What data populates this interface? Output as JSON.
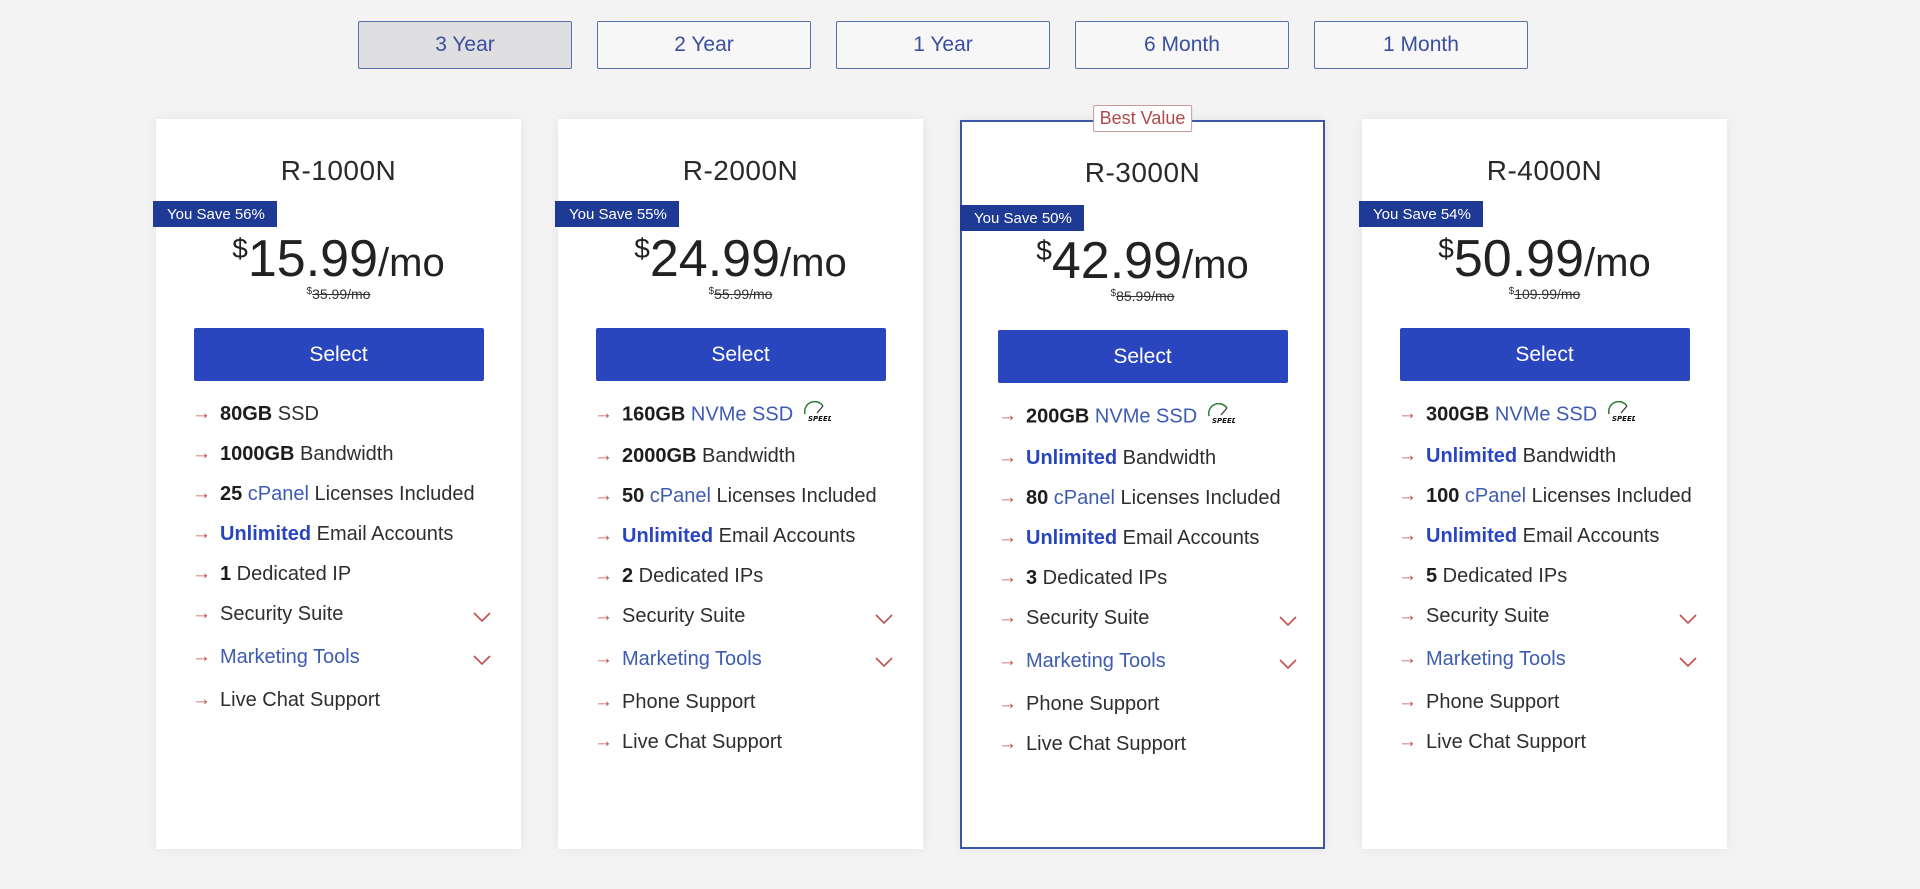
{
  "term_tabs": [
    {
      "label": "3 Year",
      "active": true
    },
    {
      "label": "2 Year",
      "active": false
    },
    {
      "label": "1 Year",
      "active": false
    },
    {
      "label": "6 Month",
      "active": false
    },
    {
      "label": "1 Month",
      "active": false
    }
  ],
  "colors": {
    "accent": "#2a46be",
    "badge": "#1f3a95",
    "arrow": "#c0504d",
    "link": "#3d5bb0"
  },
  "plans": [
    {
      "name": "R-1000N",
      "save": "You Save 56%",
      "currency": "$",
      "price": "15.99",
      "per": "/mo",
      "orig_currency": "$",
      "orig_price": "35.99/mo",
      "select": "Select",
      "featured": false,
      "features": [
        {
          "bold": "80GB",
          "rest": " SSD"
        },
        {
          "bold": "1000GB",
          "rest": " Bandwidth"
        },
        {
          "bold": "25",
          "link": " cPanel",
          "rest": " Licenses Included"
        },
        {
          "bold_blue": "Unlimited",
          "rest": " Email Accounts"
        },
        {
          "bold": "1",
          "rest": " Dedicated IP"
        },
        {
          "rest": "Security Suite",
          "expand": true
        },
        {
          "link": "Marketing Tools",
          "expand": true
        },
        {
          "rest": "Live Chat Support"
        }
      ]
    },
    {
      "name": "R-2000N",
      "save": "You Save 55%",
      "currency": "$",
      "price": "24.99",
      "per": "/mo",
      "orig_currency": "$",
      "orig_price": "55.99/mo",
      "select": "Select",
      "featured": false,
      "features": [
        {
          "bold": "160GB",
          "link": " NVMe SSD",
          "speed": "SPEED"
        },
        {
          "bold": "2000GB",
          "rest": " Bandwidth"
        },
        {
          "bold": "50",
          "link": " cPanel",
          "rest": " Licenses Included"
        },
        {
          "bold_blue": "Unlimited",
          "rest": " Email Accounts"
        },
        {
          "bold": "2",
          "rest": " Dedicated IPs"
        },
        {
          "rest": "Security Suite",
          "expand": true
        },
        {
          "link": "Marketing Tools",
          "expand": true
        },
        {
          "rest": "Phone Support"
        },
        {
          "rest": "Live Chat Support"
        }
      ]
    },
    {
      "name": "R-3000N",
      "save": "You Save 50%",
      "currency": "$",
      "price": "42.99",
      "per": "/mo",
      "orig_currency": "$",
      "orig_price": "85.99/mo",
      "select": "Select",
      "featured": true,
      "ribbon": "Best Value",
      "features": [
        {
          "bold": "200GB",
          "link": " NVMe SSD",
          "speed": "SPEED"
        },
        {
          "bold_blue": "Unlimited",
          "rest": " Bandwidth"
        },
        {
          "bold": "80",
          "link": " cPanel",
          "rest": " Licenses Included"
        },
        {
          "bold_blue": "Unlimited",
          "rest": " Email Accounts"
        },
        {
          "bold": "3",
          "rest": " Dedicated IPs"
        },
        {
          "rest": "Security Suite",
          "expand": true
        },
        {
          "link": "Marketing Tools",
          "expand": true
        },
        {
          "rest": "Phone Support"
        },
        {
          "rest": "Live Chat Support"
        }
      ]
    },
    {
      "name": "R-4000N",
      "save": "You Save 54%",
      "currency": "$",
      "price": "50.99",
      "per": "/mo",
      "orig_currency": "$",
      "orig_price": "109.99/mo",
      "select": "Select",
      "featured": false,
      "features": [
        {
          "bold": "300GB",
          "link": " NVMe SSD",
          "speed": "SPEED"
        },
        {
          "bold_blue": "Unlimited",
          "rest": " Bandwidth"
        },
        {
          "bold": "100",
          "link": " cPanel",
          "rest": " Licenses Included"
        },
        {
          "bold_blue": "Unlimited",
          "rest": " Email Accounts"
        },
        {
          "bold": "5",
          "rest": " Dedicated IPs"
        },
        {
          "rest": "Security Suite",
          "expand": true
        },
        {
          "link": "Marketing Tools",
          "expand": true
        },
        {
          "rest": "Phone Support"
        },
        {
          "rest": "Live Chat Support"
        }
      ]
    }
  ]
}
